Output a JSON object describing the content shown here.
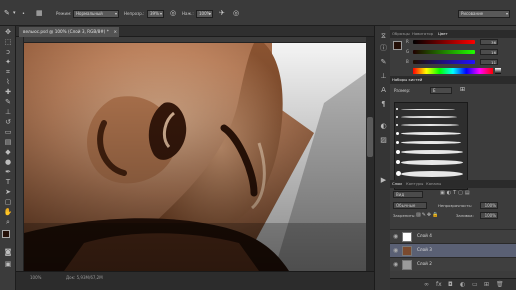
{
  "options_bar": {
    "mode_label": "Режим:",
    "mode_value": "Нормальный",
    "opacity_label": "Непрозр.:",
    "opacity_value": "39%",
    "flow_label": "Наж.:",
    "flow_value": "100%",
    "workspace_value": "Рисование"
  },
  "document": {
    "tab_title": "вельюс.psd @ 100% (Слой 3, RGB/8#) *",
    "zoom": "100%",
    "doc_info": "Док: 5,93М/67,2М"
  },
  "color_panel": {
    "tabs": [
      "Образцы",
      "Навигатор",
      "Цвет"
    ],
    "active_tab": "Цвет",
    "r_label": "R",
    "g_label": "G",
    "b_label": "B",
    "r_value": "36",
    "g_value": "16",
    "b_value": "11",
    "fg_color": "#241008",
    "bg_color": "#ffffff"
  },
  "brush_panel": {
    "title": "Наборы кистей",
    "size_label": "Размер:",
    "preset_button": "Е"
  },
  "layers_panel": {
    "tabs": [
      "Слои",
      "Контуры",
      "Каналы"
    ],
    "active_tab": "Слои",
    "kind_value": "Вид",
    "blend_value": "Обычные",
    "opacity_label": "Непрозрачность:",
    "opacity_value": "100%",
    "lock_label": "Закрепить:",
    "fill_label": "Заливка:",
    "fill_value": "100%",
    "layers": [
      {
        "name": "Слой 4",
        "selected": false
      },
      {
        "name": "Слой 3",
        "selected": true
      },
      {
        "name": "Слой 2",
        "selected": false
      }
    ]
  }
}
